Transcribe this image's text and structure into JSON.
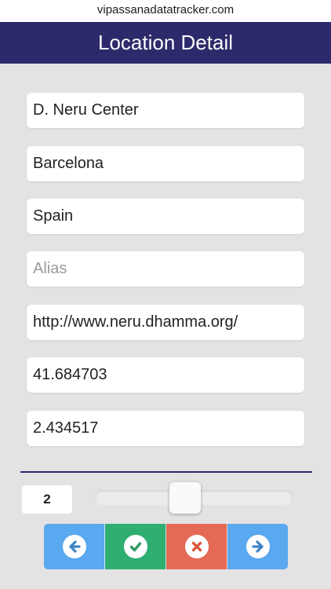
{
  "browser": {
    "url": "vipassanadatatracker.com"
  },
  "header": {
    "title": "Location Detail"
  },
  "form": {
    "name": {
      "value": "D. Neru Center",
      "placeholder": ""
    },
    "city": {
      "value": "Barcelona",
      "placeholder": ""
    },
    "country": {
      "value": "Spain",
      "placeholder": ""
    },
    "alias": {
      "value": "",
      "placeholder": "Alias"
    },
    "website": {
      "value": "http://www.neru.dhamma.org/",
      "placeholder": ""
    },
    "latitude": {
      "value": "41.684703",
      "placeholder": ""
    },
    "longitude": {
      "value": "2.434517",
      "placeholder": ""
    }
  },
  "navigator": {
    "counter": "2",
    "slider_fraction": 0.45
  },
  "actions": [
    {
      "name": "previous",
      "icon": "arrow-left-icon",
      "color": "#5aa8f0",
      "icon_color": "#3f84c9"
    },
    {
      "name": "save",
      "icon": "check-icon",
      "color": "#2fae72",
      "icon_color": "#2f9b66"
    },
    {
      "name": "delete",
      "icon": "close-icon",
      "color": "#e46a56",
      "icon_color": "#d9593f"
    },
    {
      "name": "next",
      "icon": "arrow-right-icon",
      "color": "#5aa8f0",
      "icon_color": "#3f84c9"
    }
  ],
  "colors": {
    "header": "#2c2a6a",
    "background": "#e3e3e3"
  }
}
